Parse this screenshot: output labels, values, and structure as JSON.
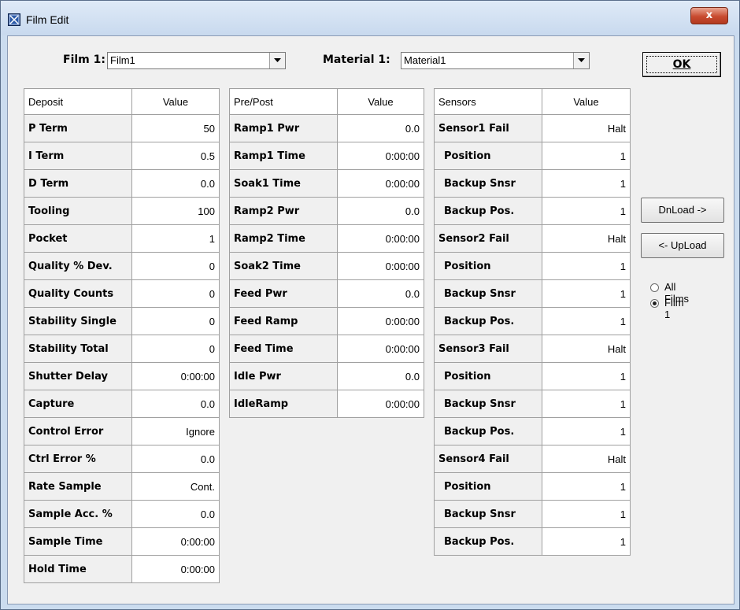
{
  "window": {
    "title": "Film Edit",
    "close_label": "x",
    "icon": "film-app-icon"
  },
  "selectors": {
    "film_label": "Film 1:",
    "film_value": "Film1",
    "material_label": "Material 1:",
    "material_value": "Material1"
  },
  "buttons": {
    "ok": "OK",
    "download": "DnLoad ->",
    "upload": "<- UpLoad"
  },
  "radios": [
    {
      "label": "All Films",
      "selected": false
    },
    {
      "label": "Film 1",
      "selected": true
    }
  ],
  "deposit": {
    "headers": [
      "Deposit",
      "Value"
    ],
    "rows": [
      {
        "name": "P Term",
        "value": "50"
      },
      {
        "name": "I Term",
        "value": "0.5"
      },
      {
        "name": "D Term",
        "value": "0.0"
      },
      {
        "name": "Tooling",
        "value": "100"
      },
      {
        "name": "Pocket",
        "value": "1"
      },
      {
        "name": "Quality % Dev.",
        "value": "0"
      },
      {
        "name": "Quality Counts",
        "value": "0"
      },
      {
        "name": "Stability Single",
        "value": "0"
      },
      {
        "name": "Stability Total",
        "value": "0"
      },
      {
        "name": "Shutter Delay",
        "value": "0:00:00"
      },
      {
        "name": "Capture",
        "value": "0.0"
      },
      {
        "name": "Control Error",
        "value": "Ignore"
      },
      {
        "name": "Ctrl Error %",
        "value": "0.0"
      },
      {
        "name": "Rate Sample",
        "value": "Cont."
      },
      {
        "name": "Sample Acc. %",
        "value": "0.0"
      },
      {
        "name": "Sample Time",
        "value": "0:00:00"
      },
      {
        "name": "Hold Time",
        "value": "0:00:00"
      }
    ]
  },
  "prepost": {
    "headers": [
      "Pre/Post",
      "Value"
    ],
    "rows": [
      {
        "name": "Ramp1 Pwr",
        "value": "0.0"
      },
      {
        "name": "Ramp1 Time",
        "value": "0:00:00"
      },
      {
        "name": "Soak1 Time",
        "value": "0:00:00"
      },
      {
        "name": "Ramp2 Pwr",
        "value": "0.0"
      },
      {
        "name": "Ramp2 Time",
        "value": "0:00:00"
      },
      {
        "name": "Soak2 Time",
        "value": "0:00:00"
      },
      {
        "name": "Feed Pwr",
        "value": "0.0"
      },
      {
        "name": "Feed Ramp",
        "value": "0:00:00"
      },
      {
        "name": "Feed Time",
        "value": "0:00:00"
      },
      {
        "name": "Idle Pwr",
        "value": "0.0"
      },
      {
        "name": "IdleRamp",
        "value": "0:00:00"
      }
    ]
  },
  "sensors": {
    "headers": [
      "Sensors",
      "Value"
    ],
    "rows": [
      {
        "name": "Sensor1 Fail",
        "value": "Halt"
      },
      {
        "name": "Position",
        "value": "1"
      },
      {
        "name": "Backup Snsr",
        "value": "1"
      },
      {
        "name": "Backup Pos.",
        "value": "1"
      },
      {
        "name": "Sensor2 Fail",
        "value": "Halt"
      },
      {
        "name": "Position",
        "value": "1"
      },
      {
        "name": "Backup Snsr",
        "value": "1"
      },
      {
        "name": "Backup Pos.",
        "value": "1"
      },
      {
        "name": "Sensor3 Fail",
        "value": "Halt"
      },
      {
        "name": "Position",
        "value": "1"
      },
      {
        "name": "Backup Snsr",
        "value": "1"
      },
      {
        "name": "Backup Pos.",
        "value": "1"
      },
      {
        "name": "Sensor4 Fail",
        "value": "Halt"
      },
      {
        "name": "Position",
        "value": "1"
      },
      {
        "name": "Backup Snsr",
        "value": "1"
      },
      {
        "name": "Backup Pos.",
        "value": "1"
      }
    ]
  }
}
